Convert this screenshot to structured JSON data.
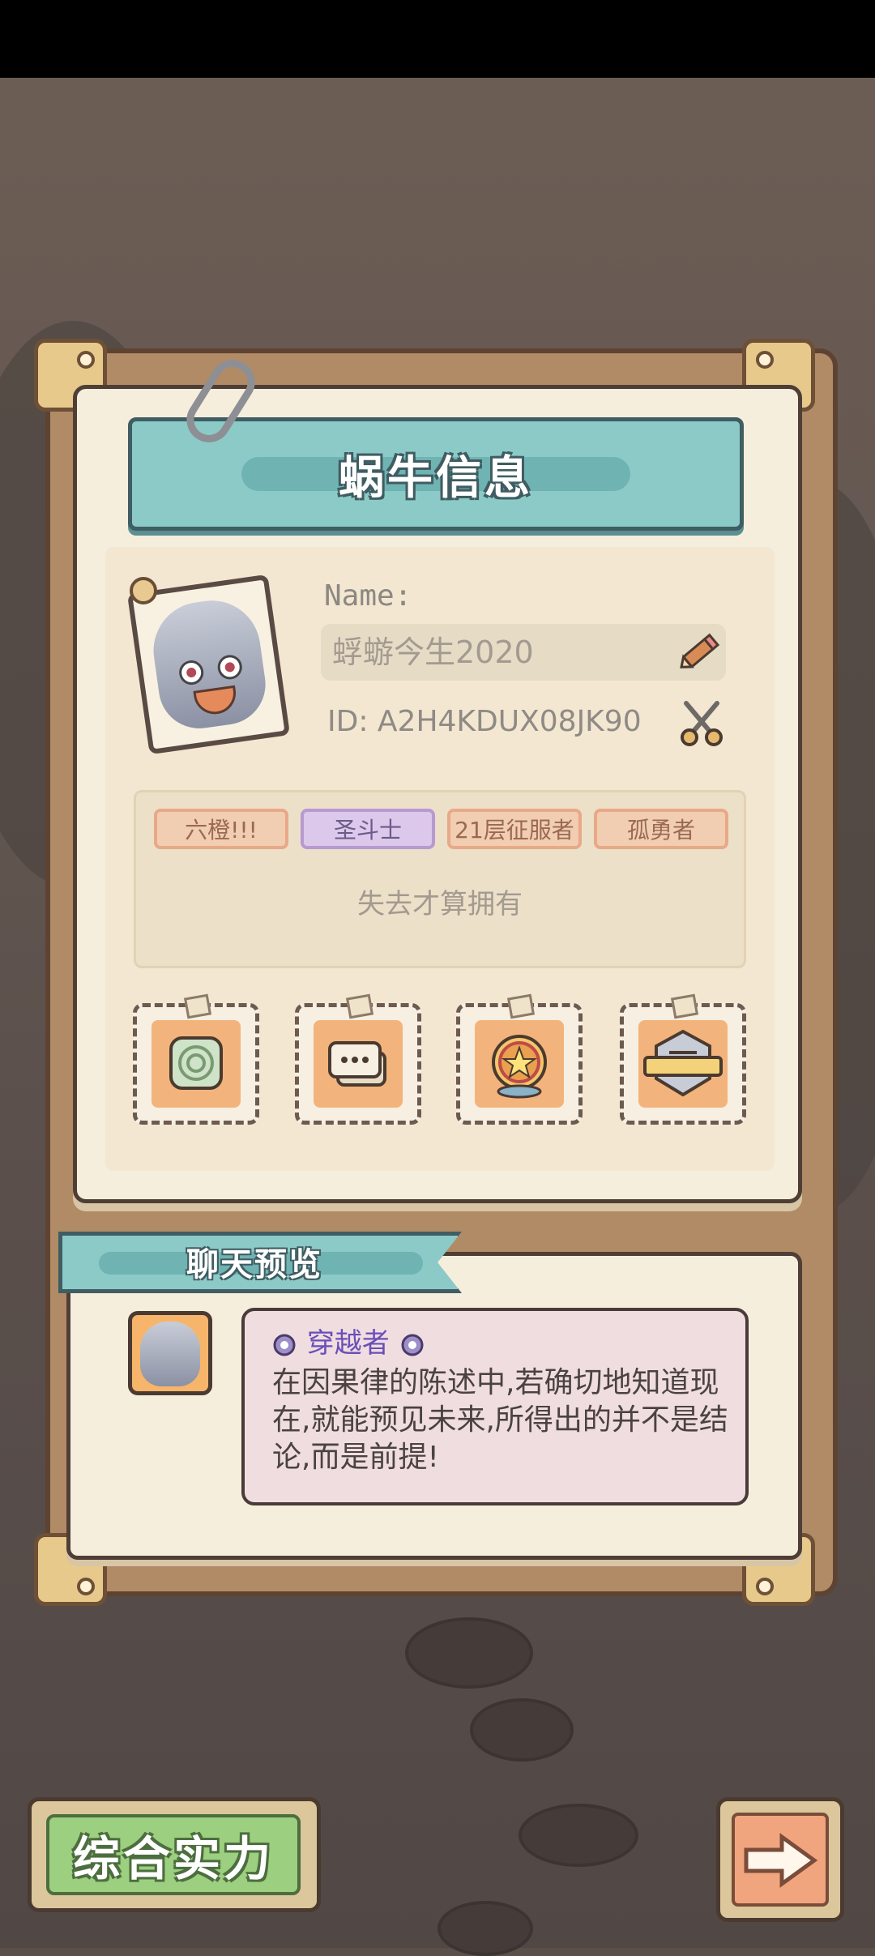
{
  "page": {
    "title": "蜗牛信息"
  },
  "profile": {
    "name_label": "Name:",
    "name_value": "蜉蝣今生2020",
    "id_text": "ID: A2H4KDUX08JK90",
    "avatar": "silver-slime-avatar"
  },
  "titles": [
    {
      "label": "六橙!!!",
      "color": "#f1cdb2"
    },
    {
      "label": "圣斗士",
      "color": "#dcc8ea"
    },
    {
      "label": "21层征服者",
      "color": "#f1cdb2"
    },
    {
      "label": "孤勇者",
      "color": "#f1cdb2"
    }
  ],
  "motto": "失去才算拥有",
  "stamps": [
    {
      "icon": "spiral-frame-icon"
    },
    {
      "icon": "chat-bubbles-icon"
    },
    {
      "icon": "star-compass-icon"
    },
    {
      "icon": "rank-badge-icon"
    }
  ],
  "chat_preview": {
    "title": "聊天预览",
    "sender_title": "穿越者",
    "message": "在因果律的陈述中,若确切地知道现在,就能预见未来,所得出的并不是结论,而是前提!"
  },
  "buttons": {
    "power": "综合实力",
    "next": "next-arrow"
  },
  "colors": {
    "banner": "#8ccac8",
    "power_button": "#9ccf7f",
    "next_button": "#f1a57e",
    "sender_name": "#6a4fb8"
  }
}
